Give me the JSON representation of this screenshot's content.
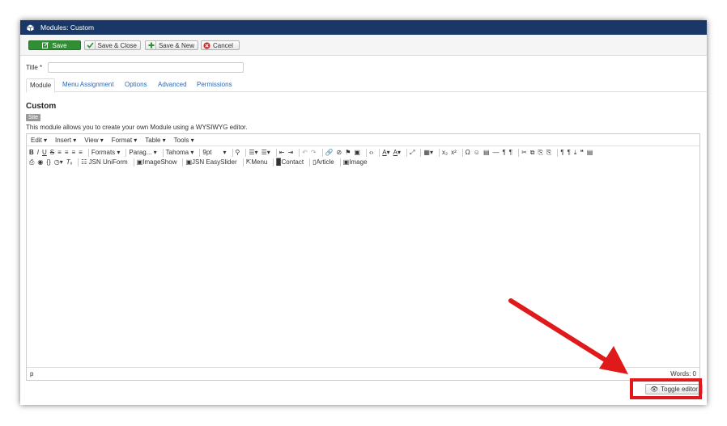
{
  "window": {
    "title": "Modules: Custom"
  },
  "toolbar": {
    "save": "Save",
    "save_close": "Save & Close",
    "save_new": "Save & New",
    "cancel": "Cancel"
  },
  "form": {
    "title_label": "Title *",
    "title_value": ""
  },
  "tabs": [
    "Module",
    "Menu Assignment",
    "Options",
    "Advanced",
    "Permissions"
  ],
  "module": {
    "heading": "Custom",
    "badge": "Site",
    "description": "This module allows you to create your own Module using a WYSIWYG editor."
  },
  "editor": {
    "menus": [
      "Edit ▾",
      "Insert ▾",
      "View ▾",
      "Format ▾",
      "Table ▾",
      "Tools ▾"
    ],
    "formats": "Formats ▾",
    "paragraph": "Parag... ▾",
    "font": "Tahoma ▾",
    "size": "9pt",
    "plugins": [
      "JSN UniForm",
      "ImageShow",
      "JSN EasySlider",
      "Menu",
      "Contact",
      "Article",
      "Image"
    ],
    "path": "p",
    "word_count": "Words: 0"
  },
  "toggle_editor": "Toggle editor",
  "colors": {
    "titlebar": "#1a3867",
    "save_green": "#2f8f32",
    "highlight_red": "#e01a1a",
    "link_blue": "#2a69b8"
  }
}
